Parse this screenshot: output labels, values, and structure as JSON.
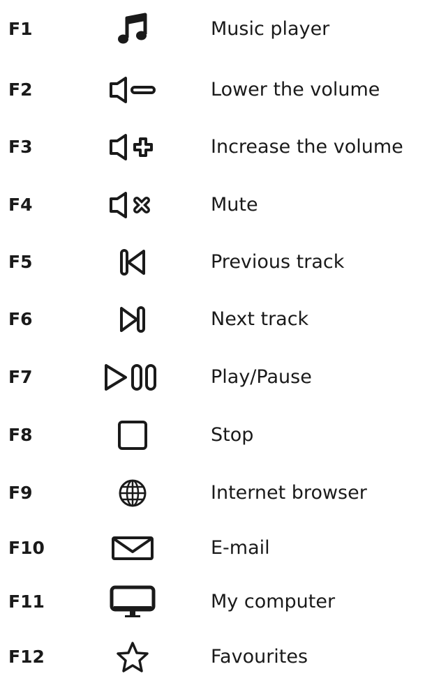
{
  "shortcuts": [
    {
      "key": "F1",
      "icon": "music-note-icon",
      "label": "Music player"
    },
    {
      "key": "F2",
      "icon": "volume-down-icon",
      "label": "Lower the volume"
    },
    {
      "key": "F3",
      "icon": "volume-up-icon",
      "label": "Increase the volume"
    },
    {
      "key": "F4",
      "icon": "mute-icon",
      "label": "Mute"
    },
    {
      "key": "F5",
      "icon": "previous-track-icon",
      "label": "Previous track"
    },
    {
      "key": "F6",
      "icon": "next-track-icon",
      "label": "Next track"
    },
    {
      "key": "F7",
      "icon": "play-pause-icon",
      "label": "Play/Pause"
    },
    {
      "key": "F8",
      "icon": "stop-icon",
      "label": "Stop"
    },
    {
      "key": "F9",
      "icon": "globe-icon",
      "label": "Internet browser"
    },
    {
      "key": "F10",
      "icon": "envelope-icon",
      "label": "E-mail"
    },
    {
      "key": "F11",
      "icon": "monitor-icon",
      "label": "My computer"
    },
    {
      "key": "F12",
      "icon": "star-icon",
      "label": "Favourites"
    }
  ],
  "colors": {
    "text": "#1a1a1a",
    "background": "#ffffff"
  }
}
